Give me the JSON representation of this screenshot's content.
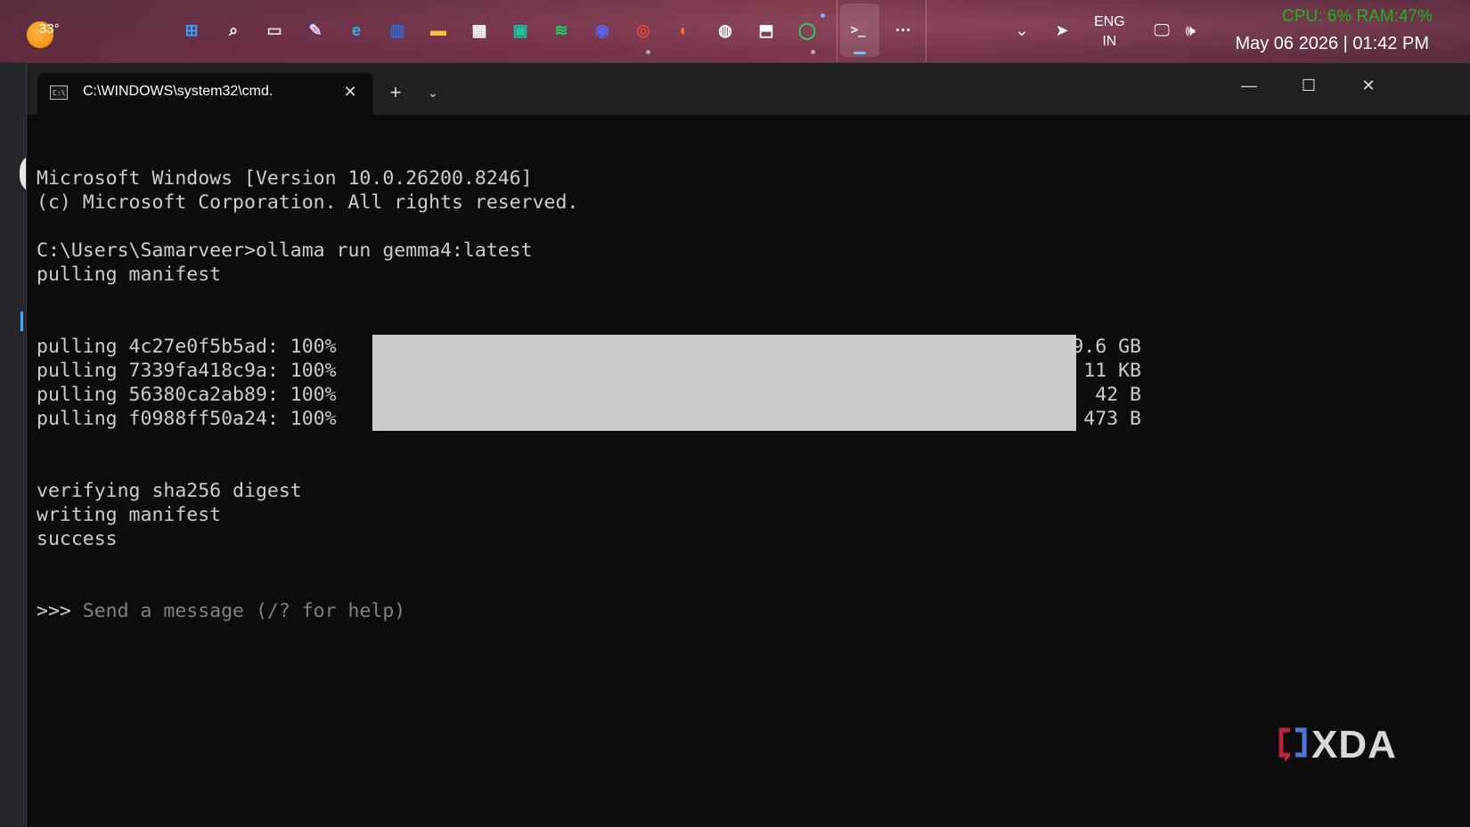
{
  "taskbar": {
    "weather_temp": "33°",
    "apps": [
      {
        "name": "windows-start-icon",
        "glyph": "⊞",
        "color": "#3aa0ff"
      },
      {
        "name": "search-icon",
        "glyph": "⌕",
        "color": "#ffffff"
      },
      {
        "name": "task-view-icon",
        "glyph": "▭",
        "color": "#dddddd"
      },
      {
        "name": "paint-icon",
        "glyph": "✎",
        "color": "#e0d0ff"
      },
      {
        "name": "edge-icon",
        "glyph": "e",
        "color": "#2fb4e8"
      },
      {
        "name": "terminal-stats-icon",
        "glyph": "▥",
        "color": "#2a6bd6"
      },
      {
        "name": "file-explorer-icon",
        "glyph": "▬",
        "color": "#f5c242"
      },
      {
        "name": "microsoft-store-icon",
        "glyph": "▦",
        "color": "#ffffff"
      },
      {
        "name": "pycharm-icon",
        "glyph": "▣",
        "color": "#1cc7a0"
      },
      {
        "name": "spotify-icon",
        "glyph": "≋",
        "color": "#1ed760"
      },
      {
        "name": "discord-icon",
        "glyph": "◉",
        "color": "#5865f2"
      },
      {
        "name": "chrome-icon",
        "glyph": "◎",
        "color": "#e8453c"
      },
      {
        "name": "firefox-icon",
        "glyph": "◐",
        "color": "#ff7139"
      },
      {
        "name": "steam-icon",
        "glyph": "◍",
        "color": "#ffffff"
      },
      {
        "name": "epic-games-icon",
        "glyph": "⬒",
        "color": "#ffffff"
      },
      {
        "name": "whatsapp-icon",
        "glyph": "◯",
        "color": "#25d366"
      },
      {
        "name": "terminal-icon",
        "glyph": ">_",
        "color": "#ffffff"
      },
      {
        "name": "more-apps-icon",
        "glyph": "···",
        "color": "#ffffff"
      }
    ],
    "tray_overflow_glyph": "⌄",
    "location_glyph": "➤",
    "lang_line1": "ENG",
    "lang_line2": "IN",
    "network_glyph": "🖵",
    "volume_glyph": "🕪",
    "stats": "CPU:  6% RAM:47%",
    "datetime": "May 06 2026 | 01:42 PM",
    "stats_color": "#1fb31f"
  },
  "window": {
    "tab_icon_text": "C:\\",
    "tab_title": "C:\\WINDOWS\\system32\\cmd.",
    "tab_close_glyph": "✕",
    "new_tab_glyph": "+",
    "dropdown_glyph": "⌄",
    "minimize_glyph": "—",
    "maximize_glyph": "☐",
    "close_glyph": "✕"
  },
  "console": {
    "lines_top": [
      "Microsoft Windows [Version 10.0.26200.8246]",
      "(c) Microsoft Corporation. All rights reserved.",
      "",
      "C:\\Users\\Samarveer>ollama run gemma4:latest",
      "pulling manifest"
    ],
    "pulls": [
      {
        "label": "pulling 4c27e0f5b5ad: 100%",
        "size": "9.6 GB",
        "progress": 1.0
      },
      {
        "label": "pulling 7339fa418c9a: 100%",
        "size": "11 KB",
        "progress": 1.0
      },
      {
        "label": "pulling 56380ca2ab89: 100%",
        "size": "42 B",
        "progress": 1.0
      },
      {
        "label": "pulling f0988ff50a24: 100%",
        "size": "473 B",
        "progress": 1.0
      }
    ],
    "lines_bottom": [
      "verifying sha256 digest",
      "writing manifest",
      "success"
    ],
    "prompt": ">>> ",
    "prompt_hint": "Send a message (/? for help)"
  },
  "watermark": {
    "text": "XDA"
  }
}
